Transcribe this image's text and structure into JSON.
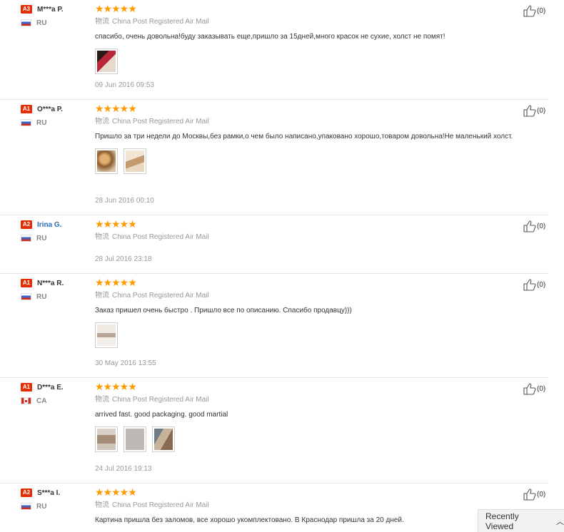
{
  "shipping_icon_text": "物流",
  "shipping_method": "China Post Registered Air Mail",
  "stars": "★★★★★",
  "reviews": [
    {
      "level": "A3",
      "name": "M***a P.",
      "country": "RU",
      "text": "спасибо, очень довольна!буду заказывать еще,пришло за 15дней,много красок не сухие, холст не помят!",
      "date": "09 Jun 2016 09:53",
      "helpful": "(0)"
    },
    {
      "level": "A1",
      "name": "O***a P.",
      "country": "RU",
      "text": "Пришло за три недели до Москвы,без рамки,о чем было написано,упаковано хорошо,товаром довольна!Не маленький холст.",
      "date": "28 Jun 2016 00:10",
      "helpful": "(0)"
    },
    {
      "level": "A2",
      "name": "Irina G.",
      "country": "RU",
      "text": "",
      "date": "28 Jul 2016 23:18",
      "helpful": "(0)"
    },
    {
      "level": "A1",
      "name": "N***a R.",
      "country": "RU",
      "text": "Заказ пришел очень быстро . Пришло все по описанию. Спасибо продавцу)))",
      "date": "30 May 2016 13:55",
      "helpful": "(0)"
    },
    {
      "level": "A1",
      "name": "D***a E.",
      "country": "CA",
      "text": "arrived fast. good packaging. good martial",
      "date": "24 Jul 2016 19:13",
      "helpful": "(0)"
    },
    {
      "level": "A2",
      "name": "S***a I.",
      "country": "RU",
      "text": "Картина пришла без заломов, все хорошо укомплектовано. В Краснодар пришла за 20 дней.",
      "date": "",
      "helpful": "(0)"
    }
  ],
  "recently_viewed": "Recently Viewed",
  "colors": {
    "level_badge": "#e62e04",
    "stars": "#ff9a00",
    "link": "#2a6ebb"
  }
}
